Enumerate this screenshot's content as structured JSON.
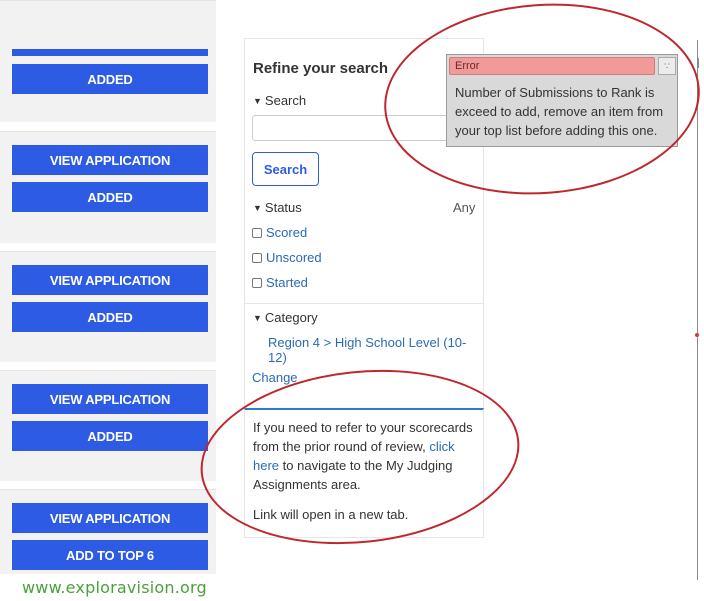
{
  "left_column": {
    "card1": {
      "button_added": "ADDED"
    },
    "card2": {
      "button_view": "VIEW APPLICATION",
      "button_added": "ADDED"
    },
    "card3": {
      "button_view": "VIEW APPLICATION",
      "button_added": "ADDED"
    },
    "card4": {
      "button_view": "VIEW APPLICATION",
      "button_added": "ADDED"
    },
    "card5": {
      "button_view": "VIEW APPLICATION",
      "button_add": "ADD TO TOP 6"
    }
  },
  "refine": {
    "title": "Refine your search",
    "search_label": "Search",
    "search_value": "",
    "search_button": "Search",
    "status_label": "Status",
    "status_value": "Any",
    "status_options": [
      "Scored",
      "Unscored",
      "Started"
    ],
    "category_label": "Category",
    "category_value": "Region 4 > High School Level (10-12)",
    "change_link": "Change"
  },
  "info": {
    "text_before": "If you need to refer to your scorecards from the prior round of review,",
    "link_text": "click here",
    "text_after": "to navigate to the My Judging Assignments area.",
    "note": "Link will open in a new tab."
  },
  "error_popup": {
    "title": "Error",
    "message": "Number of Submissions to Rank is exceed to add, remove an item from your top list before adding this one."
  },
  "footer": {
    "watermark": "www.exploravision.org"
  },
  "colors": {
    "button_blue": "#2d5be3",
    "link_blue": "#2a6bb5",
    "error_header": "#f19a9a",
    "annotation_red": "#c0272d",
    "watermark_green": "#4aa13a"
  }
}
